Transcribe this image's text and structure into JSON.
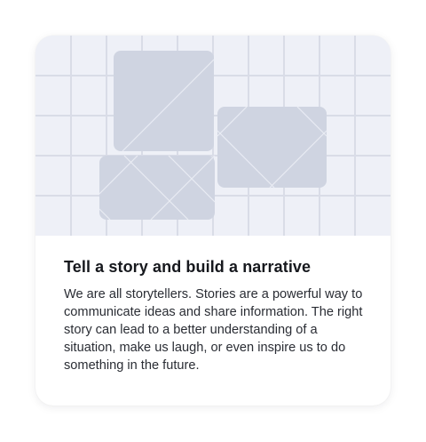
{
  "card": {
    "title": "Tell a story and build a narrative",
    "description": "We are all storytellers. Stories are a powerful way to communicate ideas and share information. The right story can lead to a better understanding of a situation, make us laugh, or even inspire us to do something in the future."
  },
  "illustration": {
    "icon": "image-placeholder-icon",
    "colors": {
      "background": "#eef0f7",
      "grid": "#d9dce7",
      "tile": "#cfd4e1",
      "tile_lines": "#e9ecf4"
    }
  }
}
